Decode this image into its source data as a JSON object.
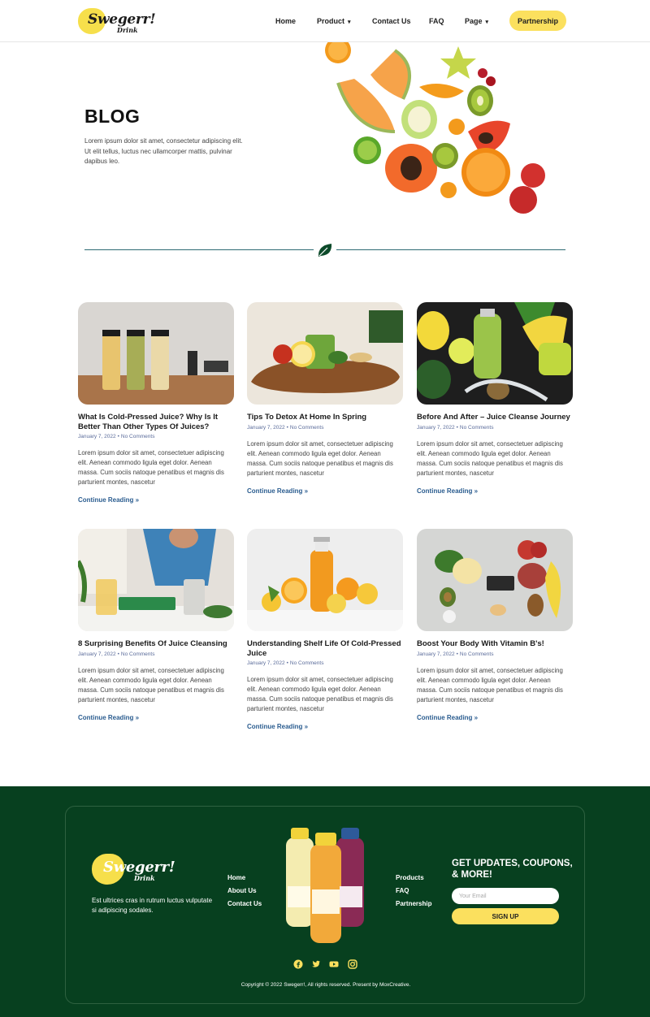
{
  "brand": {
    "name": "Swegerr!",
    "sub": "Drink"
  },
  "nav": {
    "items": [
      {
        "label": "Home",
        "caret": false
      },
      {
        "label": "Product",
        "caret": true
      },
      {
        "label": "Contact Us",
        "caret": false
      },
      {
        "label": "FAQ",
        "caret": false
      },
      {
        "label": "Page",
        "caret": true
      }
    ],
    "cta": "Partnership"
  },
  "hero": {
    "title": "BLOG",
    "text": "Lorem ipsum dolor sit amet, consectetur adipiscing elit. Ut elit tellus, luctus nec ullamcorper mattis, pulvinar dapibus leo."
  },
  "posts": [
    {
      "title": "What Is Cold-Pressed Juice? Why Is It Better Than Other Types Of Juices?",
      "date": "January 7, 2022",
      "comments": "No Comments",
      "excerpt": "Lorem ipsum dolor sit amet, consectetuer adipiscing elit. Aenean commodo ligula eget dolor. Aenean massa. Cum sociis natoque penatibus et magnis dis parturient montes, nascetur",
      "link": "Continue Reading »"
    },
    {
      "title": "Tips To Detox At Home In Spring",
      "date": "January 7, 2022",
      "comments": "No Comments",
      "excerpt": "Lorem ipsum dolor sit amet, consectetuer adipiscing elit. Aenean commodo ligula eget dolor. Aenean massa. Cum sociis natoque penatibus et magnis dis parturient montes, nascetur",
      "link": "Continue Reading »"
    },
    {
      "title": "Before And After – Juice Cleanse Journey",
      "date": "January 7, 2022",
      "comments": "No Comments",
      "excerpt": "Lorem ipsum dolor sit amet, consectetuer adipiscing elit. Aenean commodo ligula eget dolor. Aenean massa. Cum sociis natoque penatibus et magnis dis parturient montes, nascetur",
      "link": "Continue Reading »"
    },
    {
      "title": "8 Surprising Benefits Of Juice Cleansing",
      "date": "January 7, 2022",
      "comments": "No Comments",
      "excerpt": "Lorem ipsum dolor sit amet, consectetuer adipiscing elit. Aenean commodo ligula eget dolor. Aenean massa. Cum sociis natoque penatibus et magnis dis parturient montes, nascetur",
      "link": "Continue Reading »"
    },
    {
      "title": "Understanding Shelf Life Of Cold-Pressed Juice",
      "date": "January 7, 2022",
      "comments": "No Comments",
      "excerpt": "Lorem ipsum dolor sit amet, consectetuer adipiscing elit. Aenean commodo ligula eget dolor. Aenean massa. Cum sociis natoque penatibus et magnis dis parturient montes, nascetur",
      "link": "Continue Reading »"
    },
    {
      "title": "Boost Your Body With Vitamin B's!",
      "date": "January 7, 2022",
      "comments": "No Comments",
      "excerpt": "Lorem ipsum dolor sit amet, consectetuer adipiscing elit. Aenean commodo ligula eget dolor. Aenean massa. Cum sociis natoque penatibus et magnis dis parturient montes, nascetur",
      "link": "Continue Reading »"
    }
  ],
  "footer": {
    "brand": {
      "name": "Swegerr!",
      "sub": "Drink"
    },
    "tagline": "Est ultrices cras in rutrum luctus vulputate si adipiscing sodales.",
    "links_left": [
      "Home",
      "About Us",
      "Contact Us"
    ],
    "links_right": [
      "Products",
      "FAQ",
      "Partnership"
    ],
    "heading": "GET UPDATES, COUPONS, & MORE!",
    "email_placeholder": "Your Email",
    "signup": "SIGN UP",
    "social": [
      "facebook-icon",
      "twitter-icon",
      "youtube-icon",
      "instagram-icon"
    ],
    "copyright": "Copyright © 2022 Swegerr!, All rights reserved. Present by MoxCreative."
  },
  "colors": {
    "accent": "#fbe05e",
    "footer_bg": "#07401f",
    "link": "#2a5c8f",
    "divider": "#2e6b73"
  }
}
